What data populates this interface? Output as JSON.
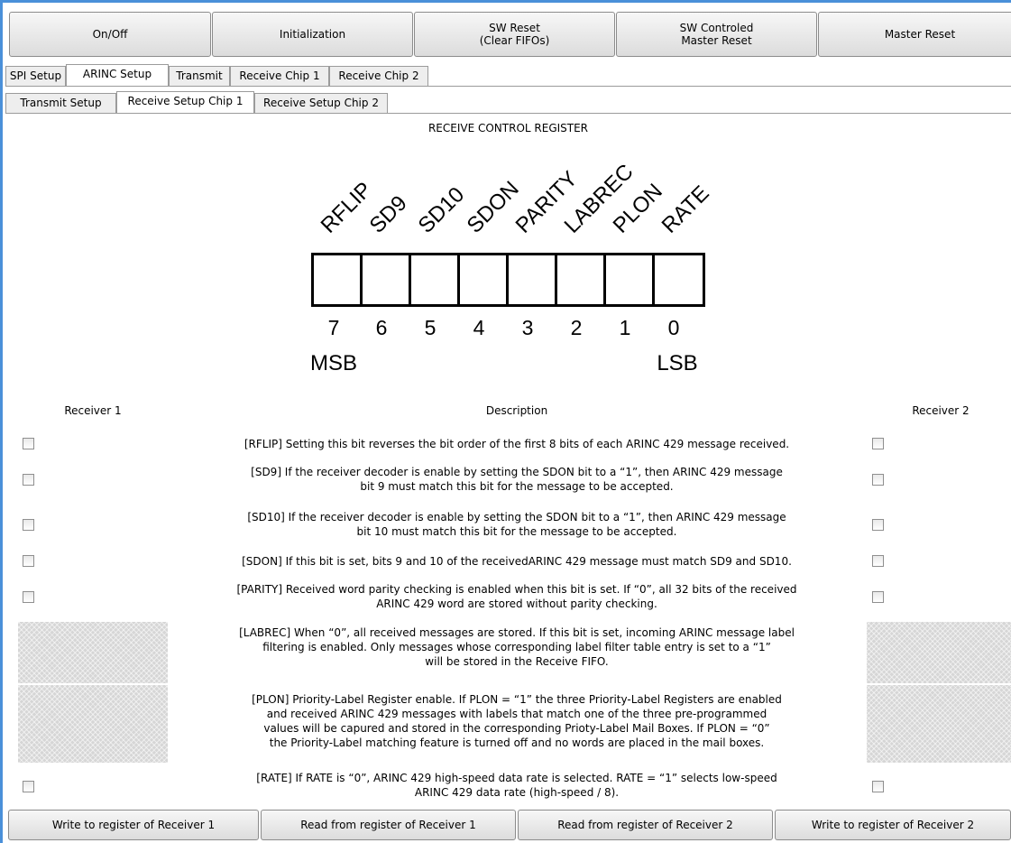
{
  "toolbar": {
    "on_off": "On/Off",
    "initialization": "Initialization",
    "sw_reset": "SW Reset\n(Clear FIFOs)",
    "sw_controlled_master_reset": "SW Controled\nMaster Reset",
    "master_reset": "Master Reset"
  },
  "main_tabs": [
    "SPI Setup",
    "ARINC Setup",
    "Transmit",
    "Receive Chip 1",
    "Receive Chip 2"
  ],
  "sub_tabs": [
    "Transmit Setup",
    "Receive Setup Chip 1",
    "Receive Setup Chip 2"
  ],
  "register": {
    "title": "RECEIVE CONTROL REGISTER",
    "bit_names": [
      "RFLIP",
      "SD9",
      "SD10",
      "SDON",
      "PARITY",
      "LABREC",
      "PLON",
      "RATE"
    ],
    "bit_numbers": [
      "7",
      "6",
      "5",
      "4",
      "3",
      "2",
      "1",
      "0"
    ],
    "msb": "MSB",
    "lsb": "LSB"
  },
  "columns": {
    "receiver1": "Receiver 1",
    "description": "Description",
    "receiver2": "Receiver 2"
  },
  "rows": [
    {
      "desc": "[RFLIP] Setting this bit reverses the bit order of the first 8 bits of each ARINC 429 message received.",
      "r1_checked": false,
      "r2_checked": false
    },
    {
      "desc": "[SD9] If the receiver decoder is enable by setting the SDON bit to a “1”, then ARINC 429 message\nbit 9 must match this bit for the message to be accepted.",
      "r1_checked": false,
      "r2_checked": false
    },
    {
      "desc": "[SD10] If the receiver decoder is enable by setting the SDON bit to a “1”, then ARINC 429 message\nbit 10 must match this bit for the message to be accepted.",
      "r1_checked": false,
      "r2_checked": false
    },
    {
      "desc": "[SDON] If this bit is set, bits 9 and 10 of the receivedARINC 429 message must match SD9 and SD10.",
      "r1_checked": false,
      "r2_checked": false
    },
    {
      "desc": "[PARITY] Received word parity checking is enabled when this bit is set. If “0”, all 32 bits of the received\nARINC 429 word are stored without parity checking.",
      "r1_checked": false,
      "r2_checked": false
    },
    {
      "desc": "[LABREC] When “0”, all received messages are stored. If this bit is set, incoming ARINC message label\nfiltering is enabled. Only messages whose corresponding label filter table entry is set to a “1”\nwill be stored in the Receive FIFO.",
      "r1_checked": null,
      "r2_checked": null
    },
    {
      "desc": "[PLON] Priority-Label Register enable. If PLON = “1” the three Priority-Label Registers are enabled\nand received ARINC 429 messages with labels that match one of the three pre-programmed\nvalues will be capured and stored in the corresponding Prioty-Label Mail Boxes. If PLON = “0”\nthe Priority-Label matching feature is turned off and no words are placed in the mail boxes.",
      "r1_checked": null,
      "r2_checked": null
    },
    {
      "desc": "[RATE] If RATE is “0”, ARINC 429 high-speed data rate is selected. RATE = “1” selects low-speed\nARINC 429 data rate (high-speed / 8).",
      "r1_checked": false,
      "r2_checked": false
    }
  ],
  "bottom_buttons": {
    "write_r1": "Write to register of Receiver 1",
    "read_r1": "Read from register of Receiver 1",
    "read_r2": "Read from register of Receiver 2",
    "write_r2": "Write to register of Receiver 2"
  },
  "colors": {
    "window_border": "#4a90d9",
    "button_face": "#e6e6e6"
  }
}
